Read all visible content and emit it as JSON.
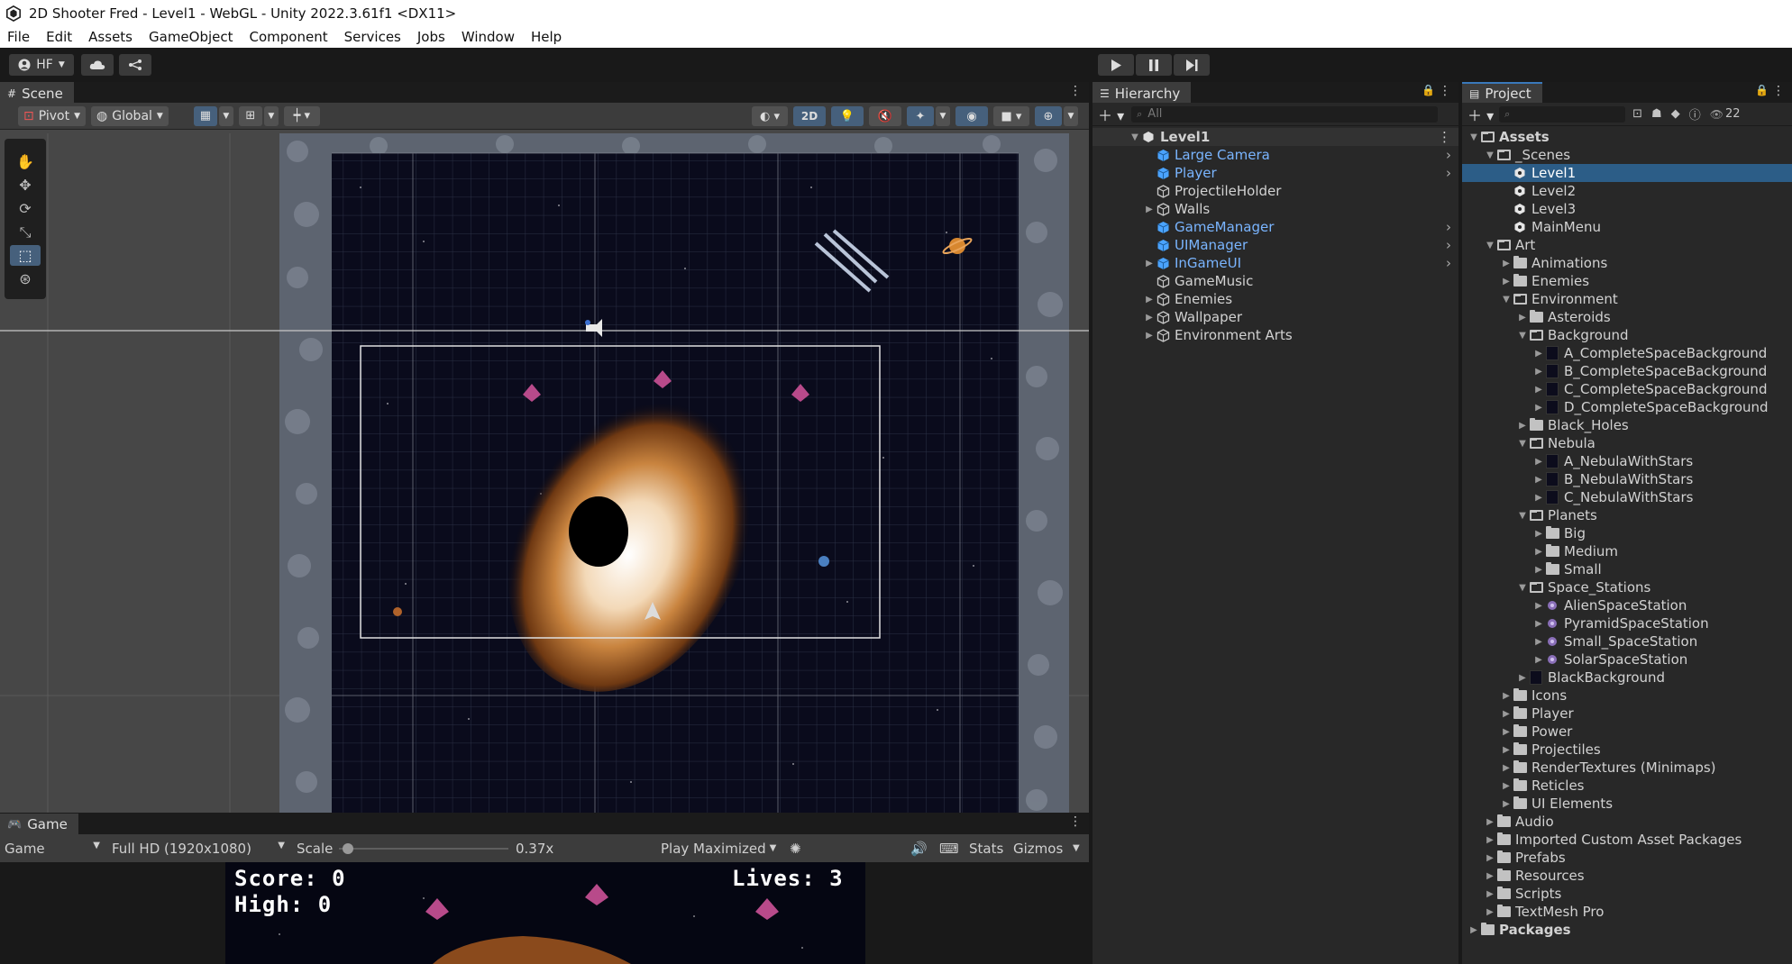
{
  "window": {
    "title": "2D Shooter Fred - Level1 - WebGL - Unity 2022.3.61f1 <DX11>"
  },
  "menu": [
    "File",
    "Edit",
    "Assets",
    "GameObject",
    "Component",
    "Services",
    "Jobs",
    "Window",
    "Help"
  ],
  "toolbar": {
    "account": "HF",
    "account_icon": "person-icon",
    "cloud_icon": "cloud-icon",
    "collab_icon": "version-control-icon",
    "play_icon": "play-icon",
    "pause_icon": "pause-icon",
    "step_icon": "step-icon"
  },
  "scene": {
    "tab_label": "Scene",
    "pivot": "Pivot",
    "global": "Global",
    "mode_2d": "2D"
  },
  "game": {
    "tab_label": "Game",
    "display": "Game",
    "resolution": "Full HD (1920x1080)",
    "scale_label": "Scale",
    "scale_value": "0.37x",
    "scale_fraction": 0.02,
    "play_mode": "Play Maximized",
    "stats": "Stats",
    "gizmos": "Gizmos",
    "score": "Score: 0",
    "high": "High: 0",
    "lives": "Lives: 3"
  },
  "hierarchy": {
    "tab_label": "Hierarchy",
    "search_placeholder": "All",
    "scene_name": "Level1",
    "items": [
      {
        "label": "Large Camera",
        "prefab": true,
        "expandable": false
      },
      {
        "label": "Player",
        "prefab": true,
        "expandable": false
      },
      {
        "label": "ProjectileHolder",
        "prefab": false,
        "expandable": false
      },
      {
        "label": "Walls",
        "prefab": false,
        "expandable": true
      },
      {
        "label": "GameManager",
        "prefab": true,
        "expandable": false
      },
      {
        "label": "UIManager",
        "prefab": true,
        "expandable": false
      },
      {
        "label": "InGameUI",
        "prefab": true,
        "expandable": true
      },
      {
        "label": "GameMusic",
        "prefab": false,
        "expandable": false
      },
      {
        "label": "Enemies",
        "prefab": false,
        "expandable": true
      },
      {
        "label": "Wallpaper",
        "prefab": false,
        "expandable": true
      },
      {
        "label": "Environment Arts",
        "prefab": false,
        "expandable": true
      }
    ]
  },
  "project": {
    "tab_label": "Project",
    "hidden_count": "22",
    "tree": [
      {
        "label": "Assets",
        "depth": 0,
        "type": "folder-open",
        "arrow": "open",
        "bold": true
      },
      {
        "label": "_Scenes",
        "depth": 1,
        "type": "folder-open",
        "arrow": "open"
      },
      {
        "label": "Level1",
        "depth": 2,
        "type": "scene",
        "arrow": "none",
        "selected": true
      },
      {
        "label": "Level2",
        "depth": 2,
        "type": "scene",
        "arrow": "none"
      },
      {
        "label": "Level3",
        "depth": 2,
        "type": "scene",
        "arrow": "none"
      },
      {
        "label": "MainMenu",
        "depth": 2,
        "type": "scene",
        "arrow": "none"
      },
      {
        "label": "Art",
        "depth": 1,
        "type": "folder-open",
        "arrow": "open"
      },
      {
        "label": "Animations",
        "depth": 2,
        "type": "folder",
        "arrow": "closed"
      },
      {
        "label": "Enemies",
        "depth": 2,
        "type": "folder",
        "arrow": "closed"
      },
      {
        "label": "Environment",
        "depth": 2,
        "type": "folder-open",
        "arrow": "open"
      },
      {
        "label": "Asteroids",
        "depth": 3,
        "type": "folder",
        "arrow": "closed"
      },
      {
        "label": "Background",
        "depth": 3,
        "type": "folder-open",
        "arrow": "open"
      },
      {
        "label": "A_CompleteSpaceBackground",
        "depth": 4,
        "type": "texture",
        "arrow": "closed"
      },
      {
        "label": "B_CompleteSpaceBackground",
        "depth": 4,
        "type": "texture",
        "arrow": "closed"
      },
      {
        "label": "C_CompleteSpaceBackground",
        "depth": 4,
        "type": "texture",
        "arrow": "closed"
      },
      {
        "label": "D_CompleteSpaceBackground",
        "depth": 4,
        "type": "texture",
        "arrow": "closed"
      },
      {
        "label": "Black_Holes",
        "depth": 3,
        "type": "folder",
        "arrow": "closed"
      },
      {
        "label": "Nebula",
        "depth": 3,
        "type": "folder-open",
        "arrow": "open"
      },
      {
        "label": "A_NebulaWithStars",
        "depth": 4,
        "type": "texture",
        "arrow": "closed"
      },
      {
        "label": "B_NebulaWithStars",
        "depth": 4,
        "type": "texture",
        "arrow": "closed"
      },
      {
        "label": "C_NebulaWithStars",
        "depth": 4,
        "type": "texture",
        "arrow": "closed"
      },
      {
        "label": "Planets",
        "depth": 3,
        "type": "folder-open",
        "arrow": "open"
      },
      {
        "label": "Big",
        "depth": 4,
        "type": "folder",
        "arrow": "closed"
      },
      {
        "label": "Medium",
        "depth": 4,
        "type": "folder",
        "arrow": "closed"
      },
      {
        "label": "Small",
        "depth": 4,
        "type": "folder",
        "arrow": "closed"
      },
      {
        "label": "Space_Stations",
        "depth": 3,
        "type": "folder-open",
        "arrow": "open"
      },
      {
        "label": "AlienSpaceStation",
        "depth": 4,
        "type": "sprite",
        "arrow": "closed"
      },
      {
        "label": "PyramidSpaceStation",
        "depth": 4,
        "type": "sprite",
        "arrow": "closed"
      },
      {
        "label": "Small_SpaceStation",
        "depth": 4,
        "type": "sprite",
        "arrow": "closed"
      },
      {
        "label": "SolarSpaceStation",
        "depth": 4,
        "type": "sprite",
        "arrow": "closed"
      },
      {
        "label": "BlackBackground",
        "depth": 3,
        "type": "texture",
        "arrow": "closed"
      },
      {
        "label": "Icons",
        "depth": 2,
        "type": "folder",
        "arrow": "closed"
      },
      {
        "label": "Player",
        "depth": 2,
        "type": "folder",
        "arrow": "closed"
      },
      {
        "label": "Power",
        "depth": 2,
        "type": "folder",
        "arrow": "closed"
      },
      {
        "label": "Projectiles",
        "depth": 2,
        "type": "folder",
        "arrow": "closed"
      },
      {
        "label": "RenderTextures (Minimaps)",
        "depth": 2,
        "type": "folder",
        "arrow": "closed"
      },
      {
        "label": "Reticles",
        "depth": 2,
        "type": "folder",
        "arrow": "closed"
      },
      {
        "label": "UI Elements",
        "depth": 2,
        "type": "folder",
        "arrow": "closed"
      },
      {
        "label": "Audio",
        "depth": 1,
        "type": "folder",
        "arrow": "closed"
      },
      {
        "label": "Imported Custom Asset Packages",
        "depth": 1,
        "type": "folder",
        "arrow": "closed"
      },
      {
        "label": "Prefabs",
        "depth": 1,
        "type": "folder",
        "arrow": "closed"
      },
      {
        "label": "Resources",
        "depth": 1,
        "type": "folder",
        "arrow": "closed"
      },
      {
        "label": "Scripts",
        "depth": 1,
        "type": "folder",
        "arrow": "closed"
      },
      {
        "label": "TextMesh Pro",
        "depth": 1,
        "type": "folder",
        "arrow": "closed"
      },
      {
        "label": "Packages",
        "depth": 0,
        "type": "folder",
        "arrow": "closed",
        "bold": true
      }
    ]
  }
}
